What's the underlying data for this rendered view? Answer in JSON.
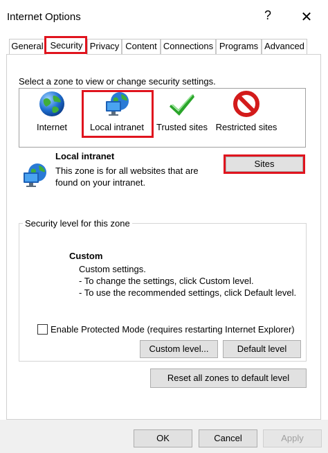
{
  "window": {
    "title": "Internet Options",
    "help_glyph": "?",
    "close_glyph": "✕"
  },
  "tabs": [
    {
      "label": "General"
    },
    {
      "label": "Security"
    },
    {
      "label": "Privacy"
    },
    {
      "label": "Content"
    },
    {
      "label": "Connections"
    },
    {
      "label": "Programs"
    },
    {
      "label": "Advanced"
    }
  ],
  "security": {
    "zone_intro": "Select a zone to view or change security settings.",
    "zones": [
      {
        "label": "Internet",
        "icon": "globe-icon"
      },
      {
        "label": "Local intranet",
        "icon": "intranet-icon"
      },
      {
        "label": "Trusted sites",
        "icon": "checkmark-icon"
      },
      {
        "label": "Restricted sites",
        "icon": "restricted-icon"
      }
    ],
    "selected_zone": {
      "name": "Local intranet",
      "description": "This zone is for all websites that are found on your intranet."
    },
    "sites_button": "Sites",
    "level_group_label": "Security level for this zone",
    "level_title": "Custom",
    "level_description": "Custom settings.\n- To change the settings, click Custom level.\n- To use the recommended settings, click Default level.",
    "protected_mode_label": "Enable Protected Mode (requires restarting Internet Explorer)",
    "protected_mode_checked": false,
    "custom_level_button": "Custom level...",
    "default_level_button": "Default level",
    "reset_all_button": "Reset all zones to default level"
  },
  "footer": {
    "ok": "OK",
    "cancel": "Cancel",
    "apply": "Apply"
  },
  "colors": {
    "highlight_red": "#e0141e",
    "button_face": "#e1e1e1",
    "disabled_text": "#a0a0a0"
  }
}
